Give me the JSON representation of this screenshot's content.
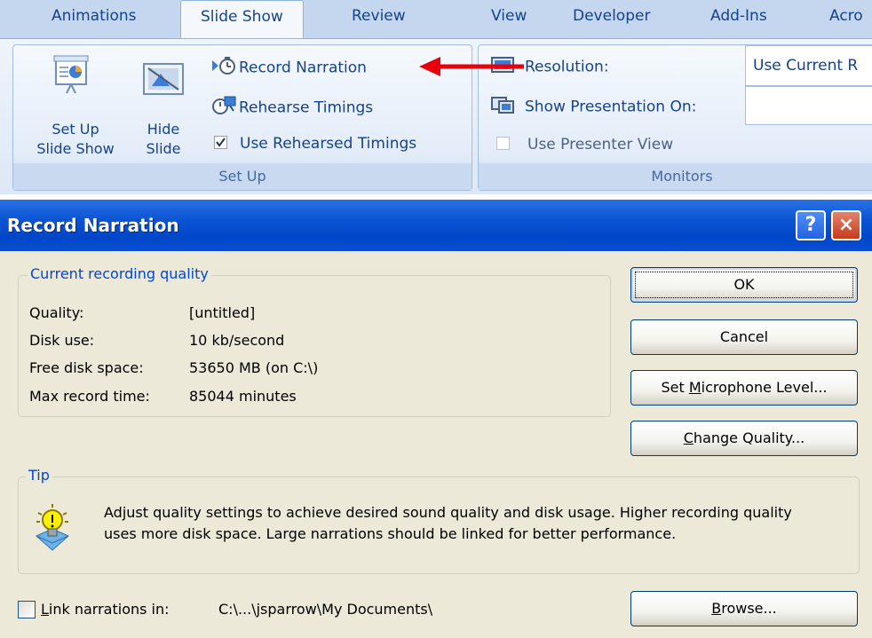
{
  "ribbon": {
    "tabs": [
      {
        "label": "Animations"
      },
      {
        "label": "Slide Show",
        "active": true
      },
      {
        "label": "Review"
      },
      {
        "label": "View"
      },
      {
        "label": "Developer"
      },
      {
        "label": "Add-Ins"
      },
      {
        "label": "Acro"
      }
    ],
    "setup_group": {
      "label": "Set Up",
      "setup_slideshow_line1": "Set Up",
      "setup_slideshow_line2": "Slide Show",
      "hide_slide_line1": "Hide",
      "hide_slide_line2": "Slide",
      "record_narration": "Record Narration",
      "rehearse_timings": "Rehearse Timings",
      "use_rehearsed_timings": "Use Rehearsed Timings",
      "use_rehearsed_checked": true
    },
    "monitors_group": {
      "label": "Monitors",
      "resolution_label": "Resolution:",
      "resolution_value": "Use Current R",
      "show_on_label": "Show Presentation On:",
      "show_on_value": "",
      "presenter_view_label": "Use Presenter View",
      "presenter_view_checked": false
    },
    "annotation_arrow_color": "#e8000b"
  },
  "dialog": {
    "title": "Record Narration",
    "help_symbol": "?",
    "close_symbol": "×",
    "quality_group": {
      "legend": "Current recording quality",
      "rows": [
        {
          "label": "Quality:",
          "value": "[untitled]"
        },
        {
          "label": "Disk use:",
          "value": "10 kb/second"
        },
        {
          "label": "Free disk space:",
          "value": "53650 MB (on C:\\)"
        },
        {
          "label": "Max record time:",
          "value": "85044 minutes"
        }
      ]
    },
    "buttons": {
      "ok": "OK",
      "cancel": "Cancel",
      "set_mic_pre": "Set ",
      "set_mic_accel": "M",
      "set_mic_post": "icrophone Level...",
      "change_quality_accel": "C",
      "change_quality_post": "hange Quality...",
      "browse_accel": "B",
      "browse_post": "rowse..."
    },
    "tip": {
      "legend": "Tip",
      "text": "Adjust quality settings to achieve desired sound quality and disk usage. Higher recording quality uses more disk space. Large narrations should be linked for better performance."
    },
    "link": {
      "checkbox_checked": false,
      "label_accel": "L",
      "label_post": "ink narrations in:",
      "path": "C:\\...\\jsparrow\\My Documents\\"
    }
  }
}
